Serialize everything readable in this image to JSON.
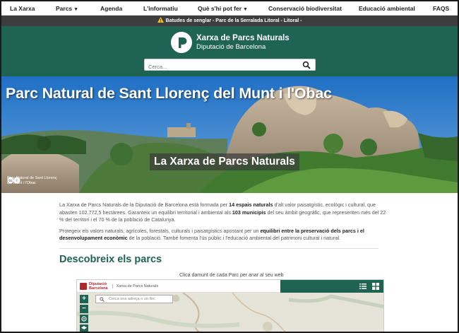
{
  "nav": {
    "items": [
      {
        "label": "La Xarxa",
        "caret": false
      },
      {
        "label": "Parcs",
        "caret": true
      },
      {
        "label": "Agenda",
        "caret": false
      },
      {
        "label": "L'informatiu",
        "caret": false
      },
      {
        "label": "Què s'hi pot fer",
        "caret": true
      },
      {
        "label": "Conservació biodiversitat",
        "caret": false
      },
      {
        "label": "Educació ambiental",
        "caret": false
      },
      {
        "label": "FAQS",
        "caret": false
      }
    ]
  },
  "alert": {
    "text": "Batudes de senglar - Parc de la Serralada Litoral - Litoral -"
  },
  "header": {
    "title": "Xarxa de Parcs Naturals",
    "subtitle": "Diputació de Barcelona",
    "search_placeholder": "Cerca..."
  },
  "hero": {
    "title": "Parc Natural de Sant Llorenç del Munt i l'Obac",
    "badge": "La Xarxa de Parcs Naturals",
    "caption_line1": "Parc Natural de Sant Llorenç",
    "caption_line2": "del Munt i l'Obac"
  },
  "intro": {
    "p1_a": "La Xarxa de Parcs Naturals de la Diputació de Barcelona està formada per ",
    "p1_b": "14 espais naturals",
    "p1_c": " d'alt valor paisatgístic, ecològic i cultural, que abasten 102.772,5 hectàrees. Garanteix un equilibri territorial i ambiental als ",
    "p1_d": "103 municipis",
    "p1_e": " del seu àmbit geogràfic, que representen més del 22 % del territori i el 70 % de la població de Catalunya.",
    "p2_a": "Protegeix els valors naturals, agrícoles, forestals, culturals i paisatgístics apostant per un ",
    "p2_b": "equilibri entre la preservació dels parcs i el desenvolupament econòmic",
    "p2_c": " de la població. També fomenta l'ús públic i l'educació ambiental del patrimoni cultural i natural."
  },
  "parks": {
    "section_title": "Descobreix els parcs",
    "hint": "Clica damunt de cada Parc per anar al seu web"
  },
  "map": {
    "brand_line1": "Diputació",
    "brand_line2": "Barcelona",
    "brand_sub": "Xarxa de Parcs Naturals",
    "search_placeholder": "Cerca una adreça o un lloc",
    "zoom_in": "+",
    "zoom_out": "−"
  },
  "colors": {
    "brand": "#1f6353",
    "alert_bg": "#3d3d3d",
    "diputacio_red": "#b1282c"
  }
}
